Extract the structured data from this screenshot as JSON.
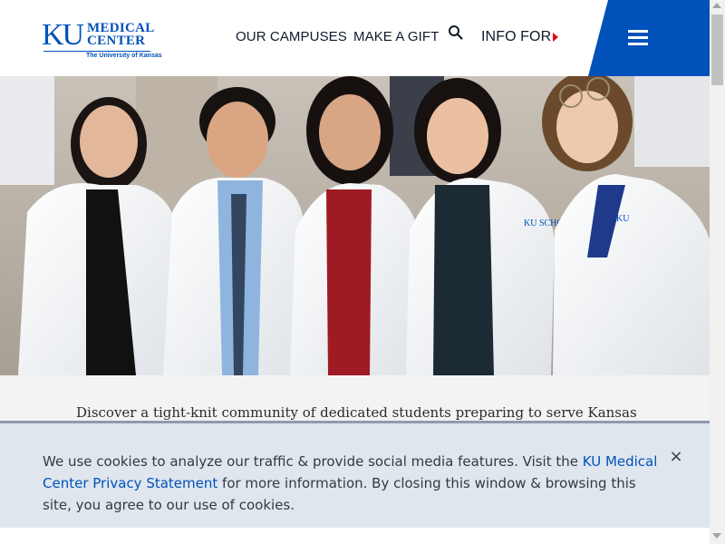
{
  "brand": {
    "logo_ku": "KU",
    "logo_line1": "MEDICAL",
    "logo_line2": "CENTER",
    "logo_sub": "The University of Kansas",
    "color_primary": "#0051ba",
    "color_accent": "#e8000d"
  },
  "nav": {
    "campuses": "OUR CAMPUSES",
    "gift": "MAKE A GIFT",
    "info": "INFO FOR",
    "search_icon": "search-icon",
    "menu_icon": "hamburger-menu-icon"
  },
  "hero": {
    "image_description": "five-students-in-white-coats",
    "coat_label_1": "KU SCHOOL OF MEDICINE",
    "coat_label_2": "KU SCHOOL OF MEDICINE"
  },
  "tagline": "Discover a tight-knit community of dedicated students preparing to serve Kansas",
  "cookie": {
    "text_before": "We use cookies to analyze our traffic & provide social media features. Visit the ",
    "link_text": "KU Medical Center Privacy Statement",
    "text_after": " for more information. By closing this window & browsing this site, you agree to our use of cookies.",
    "close_label": "×"
  }
}
